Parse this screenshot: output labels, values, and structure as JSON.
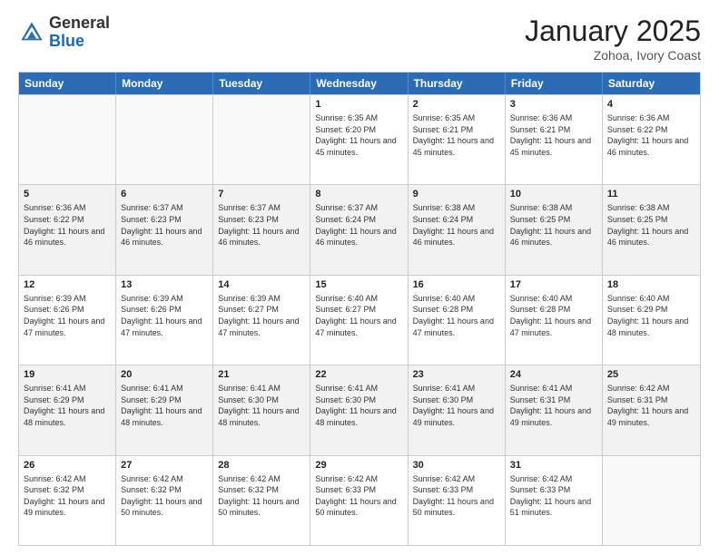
{
  "header": {
    "logo_general": "General",
    "logo_blue": "Blue",
    "month_title": "January 2025",
    "subtitle": "Zohoa, Ivory Coast"
  },
  "days_of_week": [
    "Sunday",
    "Monday",
    "Tuesday",
    "Wednesday",
    "Thursday",
    "Friday",
    "Saturday"
  ],
  "weeks": [
    [
      {
        "day": "",
        "info": "",
        "empty": true
      },
      {
        "day": "",
        "info": "",
        "empty": true
      },
      {
        "day": "",
        "info": "",
        "empty": true
      },
      {
        "day": "1",
        "info": "Sunrise: 6:35 AM\nSunset: 6:20 PM\nDaylight: 11 hours and 45 minutes."
      },
      {
        "day": "2",
        "info": "Sunrise: 6:35 AM\nSunset: 6:21 PM\nDaylight: 11 hours and 45 minutes."
      },
      {
        "day": "3",
        "info": "Sunrise: 6:36 AM\nSunset: 6:21 PM\nDaylight: 11 hours and 45 minutes."
      },
      {
        "day": "4",
        "info": "Sunrise: 6:36 AM\nSunset: 6:22 PM\nDaylight: 11 hours and 46 minutes."
      }
    ],
    [
      {
        "day": "5",
        "info": "Sunrise: 6:36 AM\nSunset: 6:22 PM\nDaylight: 11 hours and 46 minutes."
      },
      {
        "day": "6",
        "info": "Sunrise: 6:37 AM\nSunset: 6:23 PM\nDaylight: 11 hours and 46 minutes."
      },
      {
        "day": "7",
        "info": "Sunrise: 6:37 AM\nSunset: 6:23 PM\nDaylight: 11 hours and 46 minutes."
      },
      {
        "day": "8",
        "info": "Sunrise: 6:37 AM\nSunset: 6:24 PM\nDaylight: 11 hours and 46 minutes."
      },
      {
        "day": "9",
        "info": "Sunrise: 6:38 AM\nSunset: 6:24 PM\nDaylight: 11 hours and 46 minutes."
      },
      {
        "day": "10",
        "info": "Sunrise: 6:38 AM\nSunset: 6:25 PM\nDaylight: 11 hours and 46 minutes."
      },
      {
        "day": "11",
        "info": "Sunrise: 6:38 AM\nSunset: 6:25 PM\nDaylight: 11 hours and 46 minutes."
      }
    ],
    [
      {
        "day": "12",
        "info": "Sunrise: 6:39 AM\nSunset: 6:26 PM\nDaylight: 11 hours and 47 minutes."
      },
      {
        "day": "13",
        "info": "Sunrise: 6:39 AM\nSunset: 6:26 PM\nDaylight: 11 hours and 47 minutes."
      },
      {
        "day": "14",
        "info": "Sunrise: 6:39 AM\nSunset: 6:27 PM\nDaylight: 11 hours and 47 minutes."
      },
      {
        "day": "15",
        "info": "Sunrise: 6:40 AM\nSunset: 6:27 PM\nDaylight: 11 hours and 47 minutes."
      },
      {
        "day": "16",
        "info": "Sunrise: 6:40 AM\nSunset: 6:28 PM\nDaylight: 11 hours and 47 minutes."
      },
      {
        "day": "17",
        "info": "Sunrise: 6:40 AM\nSunset: 6:28 PM\nDaylight: 11 hours and 47 minutes."
      },
      {
        "day": "18",
        "info": "Sunrise: 6:40 AM\nSunset: 6:29 PM\nDaylight: 11 hours and 48 minutes."
      }
    ],
    [
      {
        "day": "19",
        "info": "Sunrise: 6:41 AM\nSunset: 6:29 PM\nDaylight: 11 hours and 48 minutes."
      },
      {
        "day": "20",
        "info": "Sunrise: 6:41 AM\nSunset: 6:29 PM\nDaylight: 11 hours and 48 minutes."
      },
      {
        "day": "21",
        "info": "Sunrise: 6:41 AM\nSunset: 6:30 PM\nDaylight: 11 hours and 48 minutes."
      },
      {
        "day": "22",
        "info": "Sunrise: 6:41 AM\nSunset: 6:30 PM\nDaylight: 11 hours and 48 minutes."
      },
      {
        "day": "23",
        "info": "Sunrise: 6:41 AM\nSunset: 6:30 PM\nDaylight: 11 hours and 49 minutes."
      },
      {
        "day": "24",
        "info": "Sunrise: 6:41 AM\nSunset: 6:31 PM\nDaylight: 11 hours and 49 minutes."
      },
      {
        "day": "25",
        "info": "Sunrise: 6:42 AM\nSunset: 6:31 PM\nDaylight: 11 hours and 49 minutes."
      }
    ],
    [
      {
        "day": "26",
        "info": "Sunrise: 6:42 AM\nSunset: 6:32 PM\nDaylight: 11 hours and 49 minutes."
      },
      {
        "day": "27",
        "info": "Sunrise: 6:42 AM\nSunset: 6:32 PM\nDaylight: 11 hours and 50 minutes."
      },
      {
        "day": "28",
        "info": "Sunrise: 6:42 AM\nSunset: 6:32 PM\nDaylight: 11 hours and 50 minutes."
      },
      {
        "day": "29",
        "info": "Sunrise: 6:42 AM\nSunset: 6:33 PM\nDaylight: 11 hours and 50 minutes."
      },
      {
        "day": "30",
        "info": "Sunrise: 6:42 AM\nSunset: 6:33 PM\nDaylight: 11 hours and 50 minutes."
      },
      {
        "day": "31",
        "info": "Sunrise: 6:42 AM\nSunset: 6:33 PM\nDaylight: 11 hours and 51 minutes."
      },
      {
        "day": "",
        "info": "",
        "empty": true
      }
    ]
  ]
}
